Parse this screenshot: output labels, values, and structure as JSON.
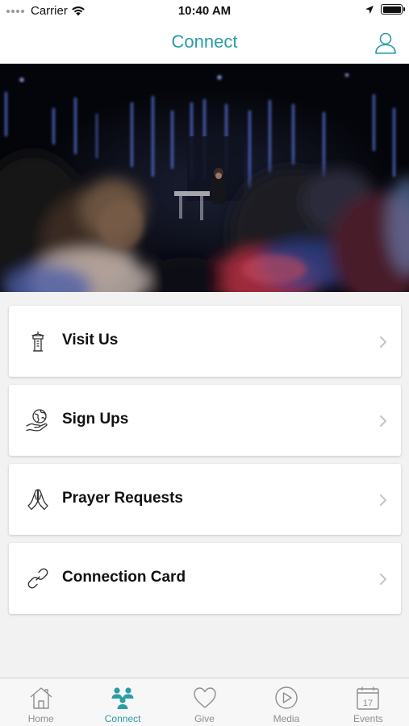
{
  "status_bar": {
    "carrier": "Carrier",
    "time": "10:40 AM"
  },
  "nav": {
    "title": "Connect",
    "profile_icon": "person-icon"
  },
  "hero": {
    "image": "worship-stage-photo"
  },
  "menu": [
    {
      "label": "Visit Us",
      "icon": "building-icon"
    },
    {
      "label": "Sign Ups",
      "icon": "globe-hand-icon"
    },
    {
      "label": "Prayer Requests",
      "icon": "praying-hands-icon"
    },
    {
      "label": "Connection Card",
      "icon": "link-icon"
    }
  ],
  "tabs": [
    {
      "label": "Home",
      "icon": "home-icon",
      "active": false
    },
    {
      "label": "Connect",
      "icon": "people-icon",
      "active": true
    },
    {
      "label": "Give",
      "icon": "heart-icon",
      "active": false
    },
    {
      "label": "Media",
      "icon": "play-icon",
      "active": false
    },
    {
      "label": "Events",
      "icon": "calendar-icon",
      "active": false
    },
    {
      "calendar_day": "17"
    }
  ],
  "colors": {
    "accent": "#2a9ca6",
    "inactive": "#8e8e8e",
    "background": "#f2f2f2"
  }
}
